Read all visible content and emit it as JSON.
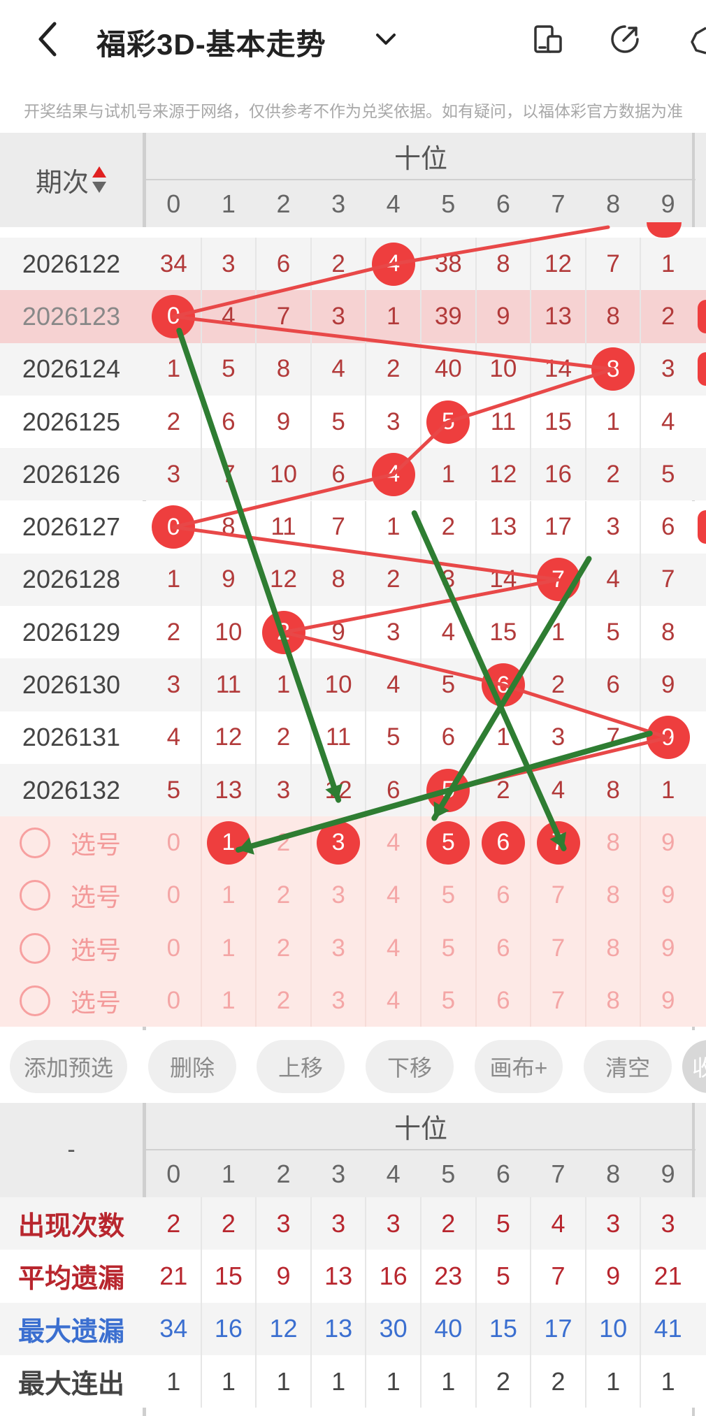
{
  "header": {
    "title": "福彩3D-基本走势",
    "disclaimer": "开奖结果与试机号来源于网络，仅供参考不作为兑奖依据。如有疑问，以福体彩官方数据为准"
  },
  "table": {
    "period_header": "期次",
    "group_header": "十位",
    "digits": [
      "0",
      "1",
      "2",
      "3",
      "4",
      "5",
      "6",
      "7",
      "8",
      "9"
    ],
    "rows": [
      {
        "period": "2026122",
        "values": [
          "34",
          "3",
          "6",
          "2",
          "4",
          "38",
          "8",
          "12",
          "7",
          "1"
        ],
        "hit": 4
      },
      {
        "period": "2026123",
        "values": [
          "0",
          "4",
          "7",
          "3",
          "1",
          "39",
          "9",
          "13",
          "8",
          "2"
        ],
        "hit": 0
      },
      {
        "period": "2026124",
        "values": [
          "1",
          "5",
          "8",
          "4",
          "2",
          "40",
          "10",
          "14",
          "8",
          "3"
        ],
        "hit": 8
      },
      {
        "period": "2026125",
        "values": [
          "2",
          "6",
          "9",
          "5",
          "3",
          "5",
          "11",
          "15",
          "1",
          "4"
        ],
        "hit": 5
      },
      {
        "period": "2026126",
        "values": [
          "3",
          "7",
          "10",
          "6",
          "4",
          "1",
          "12",
          "16",
          "2",
          "5"
        ],
        "hit": 4
      },
      {
        "period": "2026127",
        "values": [
          "0",
          "8",
          "11",
          "7",
          "1",
          "2",
          "13",
          "17",
          "3",
          "6"
        ],
        "hit": 0
      },
      {
        "period": "2026128",
        "values": [
          "1",
          "9",
          "12",
          "8",
          "2",
          "3",
          "14",
          "7",
          "4",
          "7"
        ],
        "hit": 7
      },
      {
        "period": "2026129",
        "values": [
          "2",
          "10",
          "2",
          "9",
          "3",
          "4",
          "15",
          "1",
          "5",
          "8"
        ],
        "hit": 2
      },
      {
        "period": "2026130",
        "values": [
          "3",
          "11",
          "1",
          "10",
          "4",
          "5",
          "6",
          "2",
          "6",
          "9"
        ],
        "hit": 6
      },
      {
        "period": "2026131",
        "values": [
          "4",
          "12",
          "2",
          "11",
          "5",
          "6",
          "1",
          "3",
          "7",
          "9"
        ],
        "hit": 9
      },
      {
        "period": "2026132",
        "values": [
          "5",
          "13",
          "3",
          "12",
          "6",
          "5",
          "2",
          "4",
          "8",
          "1"
        ],
        "hit": 5
      }
    ],
    "select_rows": [
      {
        "label": "选号",
        "selected": [
          1,
          3,
          5,
          6,
          7
        ]
      },
      {
        "label": "选号",
        "selected": []
      },
      {
        "label": "选号",
        "selected": []
      },
      {
        "label": "选号",
        "selected": []
      }
    ]
  },
  "buttons": [
    "添加预选",
    "删除",
    "上移",
    "下移",
    "画布+",
    "清空",
    "收"
  ],
  "stats": {
    "corner": "-",
    "group_header": "十位",
    "digits": [
      "0",
      "1",
      "2",
      "3",
      "4",
      "5",
      "6",
      "7",
      "8",
      "9"
    ],
    "rows": [
      {
        "label": "出现次数",
        "values": [
          "2",
          "2",
          "3",
          "3",
          "3",
          "2",
          "5",
          "4",
          "3",
          "3"
        ],
        "color": "#b8262e"
      },
      {
        "label": "平均遗漏",
        "values": [
          "21",
          "15",
          "9",
          "13",
          "16",
          "23",
          "5",
          "7",
          "9",
          "21"
        ],
        "color": "#b8262e"
      },
      {
        "label": "最大遗漏",
        "values": [
          "34",
          "16",
          "12",
          "13",
          "30",
          "40",
          "15",
          "17",
          "10",
          "41"
        ],
        "color": "#3b6fd0"
      },
      {
        "label": "最大连出",
        "values": [
          "1",
          "1",
          "1",
          "1",
          "1",
          "1",
          "2",
          "2",
          "1",
          "1"
        ],
        "color": "#444444"
      }
    ]
  },
  "colors": {
    "accent": "#ee3e3e",
    "trend_line": "#e84848",
    "drawn_line": "#2e7d32",
    "highlight_row": "#f6d2d2",
    "select_bg": "#fde9e6"
  },
  "icons": [
    "back-arrow-icon",
    "chevron-down-icon",
    "tablet-icon",
    "share-icon",
    "settings-icon",
    "sort-arrows-icon"
  ]
}
